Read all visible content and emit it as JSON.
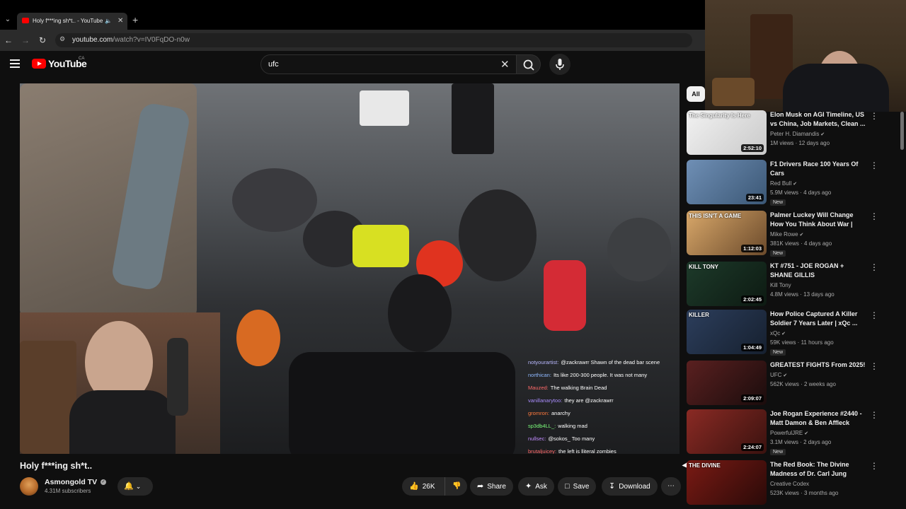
{
  "browser": {
    "tab_title": "Holy f***ing sh*t.. - YouTube",
    "new_tab_icon": "plus-icon",
    "url_host": "youtube.com",
    "url_path": "/watch?v=IV0FqDO-n0w"
  },
  "youtube": {
    "brand": "YouTube",
    "country": "CA",
    "search_value": "ufc"
  },
  "video": {
    "title": "Holy f***ing sh*t..",
    "chat": [
      {
        "user": "notyourartist:",
        "user_color": "#b9b9ff",
        "text": "@zackrawrr Shawn of the dead bar scene"
      },
      {
        "user": "northican:",
        "user_color": "#8fb8ff",
        "text": "Its like 200-300 people. It was not many"
      },
      {
        "user": "Mauzed:",
        "user_color": "#ff6a6a",
        "text": "The walking Brain Dead"
      },
      {
        "user": "vanillanarytoo:",
        "user_color": "#a78bfa",
        "text": "they are @zackrawrr"
      },
      {
        "user": "gromron:",
        "user_color": "#ff7a3d",
        "text": "anarchy"
      },
      {
        "user": "sp3db4LL_:",
        "user_color": "#7cff7c",
        "text": "walking mad"
      },
      {
        "user": "nullsec:",
        "user_color": "#c08cff",
        "text": "@sokos_ Too many"
      },
      {
        "user": "brutaljuicey:",
        "user_color": "#ff6a6a",
        "text": "the left is lliteral zombies"
      }
    ]
  },
  "channel": {
    "name": "Asmongold TV",
    "subscribers": "4.31M subscribers"
  },
  "actions": {
    "likes": "26K",
    "share": "Share",
    "ask": "Ask",
    "save": "Save",
    "download": "Download"
  },
  "sidebar": {
    "chip_all": "All",
    "items": [
      {
        "title": "Elon Musk on AGI Timeline, US vs China, Job Markets, Clean ...",
        "channel": "Peter H. Diamandis",
        "verified": true,
        "meta": "1M views · 12 days ago",
        "duration": "2:52:10",
        "is_new": false,
        "new_label": "",
        "thumb_text": "The Singularity Is Here",
        "thumb_colors": [
          "#f2f2f2",
          "#c9c9c9"
        ]
      },
      {
        "title": "F1 Drivers Race 100 Years Of Cars",
        "channel": "Red Bull",
        "verified": true,
        "meta": "5.9M views · 4 days ago",
        "duration": "23:41",
        "is_new": true,
        "new_label": "New",
        "thumb_text": "",
        "thumb_colors": [
          "#6f8fb5",
          "#3b5775"
        ]
      },
      {
        "title": "Palmer Luckey Will Change How You Think About War | #464 | ...",
        "channel": "Mike Rowe",
        "verified": true,
        "meta": "381K views · 4 days ago",
        "duration": "1:12:03",
        "is_new": true,
        "new_label": "New",
        "thumb_text": "THIS ISN'T A GAME",
        "thumb_colors": [
          "#d9a86a",
          "#6b4a2b"
        ]
      },
      {
        "title": "KT #751 - JOE ROGAN + SHANE GILLIS",
        "channel": "Kill Tony",
        "verified": false,
        "meta": "4.8M views · 13 days ago",
        "duration": "2:02:45",
        "is_new": false,
        "new_label": "",
        "thumb_text": "KILL TONY",
        "thumb_colors": [
          "#1d3a2a",
          "#0d1a12"
        ]
      },
      {
        "title": "How Police Captured A Killer Soldier 7 Years Later | xQc ...",
        "channel": "xQc",
        "verified": true,
        "meta": "59K views · 11 hours ago",
        "duration": "1:04:49",
        "is_new": true,
        "new_label": "New",
        "thumb_text": "KILLER",
        "thumb_colors": [
          "#2c3e5c",
          "#16202f"
        ]
      },
      {
        "title": "GREATEST FIGHTS From 2025!",
        "channel": "UFC",
        "verified": true,
        "meta": "562K views · 2 weeks ago",
        "duration": "2:09:07",
        "is_new": false,
        "new_label": "",
        "thumb_text": "",
        "thumb_colors": [
          "#5a2020",
          "#1a0c0c"
        ]
      },
      {
        "title": "Joe Rogan Experience #2440 - Matt Damon & Ben Affleck",
        "channel": "PowerfulJRE",
        "verified": true,
        "meta": "3.1M views · 2 days ago",
        "duration": "2:24:07",
        "is_new": true,
        "new_label": "New",
        "thumb_text": "",
        "thumb_colors": [
          "#8a2a24",
          "#3a120f"
        ]
      },
      {
        "title": "The Red Book: The Divine Madness of Dr. Carl Jung",
        "channel": "Creative Codex",
        "verified": false,
        "meta": "523K views · 3 months ago",
        "duration": "",
        "is_new": false,
        "new_label": "",
        "thumb_text": "THE DIVINE",
        "thumb_colors": [
          "#7a1a14",
          "#2a0a08"
        ]
      }
    ]
  },
  "icons": {
    "menu": "hamburger-icon",
    "search": "search-icon",
    "mic": "mic-icon",
    "bell": "bell-icon",
    "like": "thumbs-up-icon",
    "dislike": "thumbs-down-icon",
    "share": "share-arrow-icon",
    "ask": "sparkle-icon",
    "save": "bookmark-icon",
    "download": "download-icon",
    "more": "more-horizontal-icon"
  }
}
